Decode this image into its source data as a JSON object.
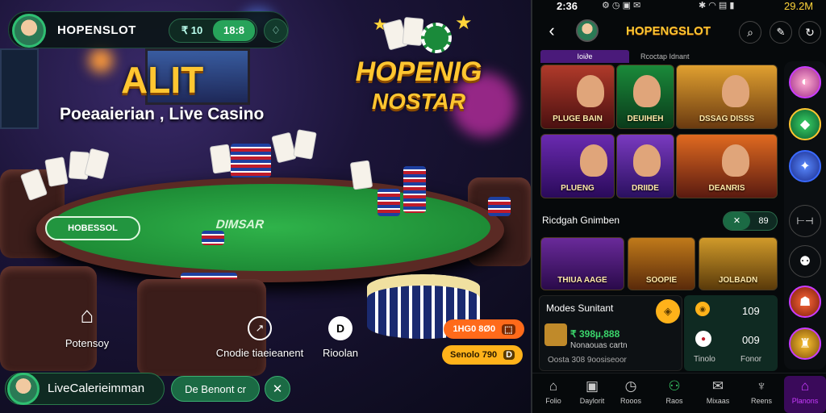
{
  "left": {
    "brand": "HOPENSLOT",
    "topbar": {
      "pill_left": "₹ 10",
      "pill_right": "18:8"
    },
    "hero": {
      "alt": "ALIT",
      "subtitle": "Poeaaierian , Live Casino"
    },
    "logo": {
      "line1": "HOPENIG",
      "line2": "NOSTAR"
    },
    "table_text": {
      "left": "HOBESSOL",
      "mid": "DIMSAR"
    },
    "actions": [
      {
        "label": "Potensoy",
        "icon": "bookmark-icon"
      },
      {
        "label": "Cnodie tiaeieanent",
        "icon": "chart-icon"
      },
      {
        "label": "Rioolan",
        "icon": "d-circle-icon"
      }
    ],
    "promo": [
      {
        "label": "1HG0 8Ø0"
      },
      {
        "label": "Senolo 790"
      }
    ],
    "bottom": {
      "text": "LiveCalerieimman",
      "button": "De Benont cr"
    }
  },
  "right": {
    "status": {
      "time": "2:36",
      "right": "29.2M"
    },
    "header": {
      "title": "HOPENGSLOT"
    },
    "tabs": [
      "Ioi∂e",
      "Rcoctap Idnant"
    ],
    "tiles_row1": [
      "PLUGE BAIN",
      "DEUIHEH",
      "DSSAG DISSS"
    ],
    "tiles_row2": [
      "PLUENG",
      "DRIIDE",
      "DEANRIS"
    ],
    "section_title": "Ricdgah Gnimben",
    "section_pill": [
      "✕",
      "89"
    ],
    "tiles_row3": [
      "THIUA AAGE",
      "SOOPIE",
      "JOLBADN"
    ],
    "promo_card": {
      "title": "Modes Sunitant",
      "amount": "₹ 398µ,888",
      "line1": "Nonaouas cartn",
      "line2": "Oosta 308 9oosiseoor",
      "right_top": "109",
      "right_mid": "009",
      "right_lbl1": "Tinolo",
      "right_lbl2": "Fonor"
    },
    "nav": [
      "Folio",
      "Daylorit",
      "Rooos",
      "Raos",
      "Mixaas",
      "Reens",
      "Planons"
    ],
    "accent": "#c93cff",
    "gold": "#ffc631"
  }
}
